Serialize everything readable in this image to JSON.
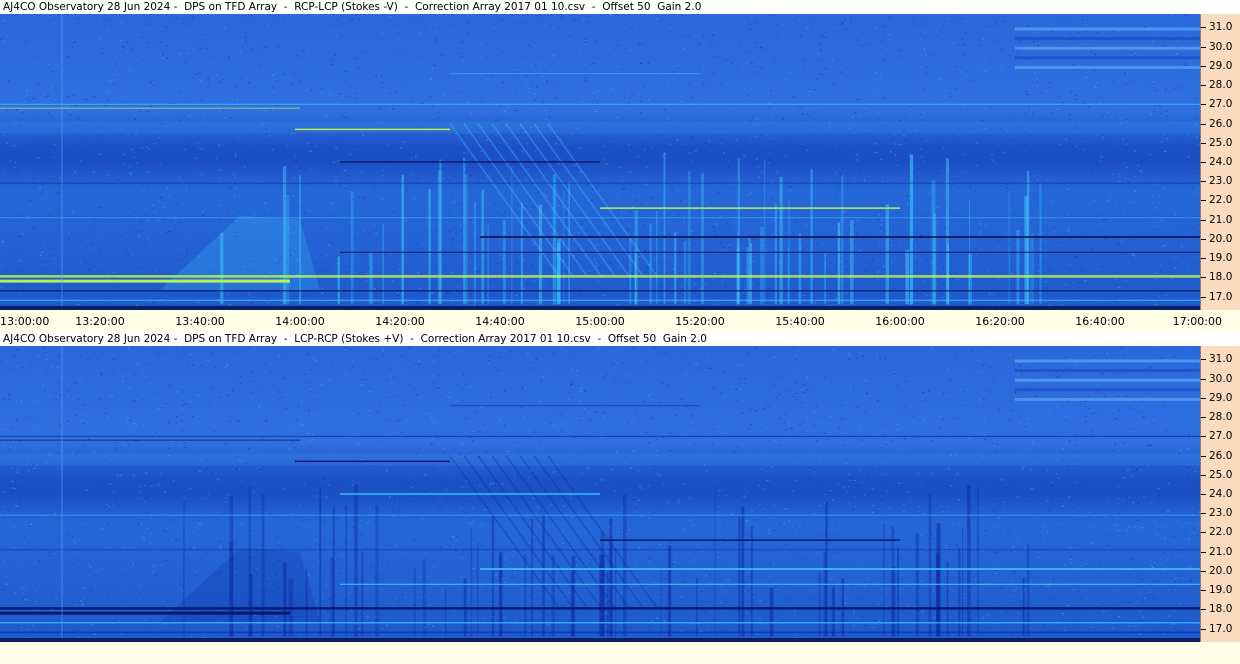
{
  "chart_data": [
    {
      "type": "heatmap",
      "title": "AJ4CO Observatory 28 Jun 2024 -  DPS on TFD Array  -  RCP-LCP (Stokes -V)  -  Correction Array 2017 01 10.csv  -  Offset 50  Gain 2.0",
      "x_ticks": [
        "13:00:00",
        "13:20:00",
        "13:40:00",
        "14:00:00",
        "14:20:00",
        "14:40:00",
        "15:00:00",
        "15:20:00",
        "15:40:00",
        "16:00:00",
        "16:20:00",
        "16:40:00",
        "17:00:00"
      ],
      "y_ticks": [
        "31.0",
        "30.0",
        "29.0",
        "28.0",
        "27.0",
        "26.0",
        "25.0",
        "24.0",
        "23.0",
        "22.0",
        "21.0",
        "20.0",
        "19.0",
        "18.0",
        "17.0"
      ],
      "ylim": [
        16.3,
        31.7
      ],
      "xlabel": "",
      "ylabel": "",
      "colormap": [
        "#0a1a8a",
        "#1f5fd6",
        "#2aa8f0",
        "#c8ff40"
      ],
      "polarity": "positive"
    },
    {
      "type": "heatmap",
      "title": "AJ4CO Observatory 28 Jun 2024 -  DPS on TFD Array  -  LCP-RCP (Stokes +V)  -  Correction Array 2017 01 10.csv  -  Offset 50  Gain 2.0",
      "x_ticks": [],
      "y_ticks": [
        "31.0",
        "30.0",
        "29.0",
        "28.0",
        "27.0",
        "26.0",
        "25.0",
        "24.0",
        "23.0",
        "22.0",
        "21.0",
        "20.0",
        "19.0",
        "18.0",
        "17.0"
      ],
      "ylim": [
        16.3,
        31.7
      ],
      "xlabel": "",
      "ylabel": "",
      "colormap": [
        "#0a1a8a",
        "#1f5fd6",
        "#2aa8f0",
        "#c8ff40"
      ],
      "polarity": "negative"
    }
  ]
}
